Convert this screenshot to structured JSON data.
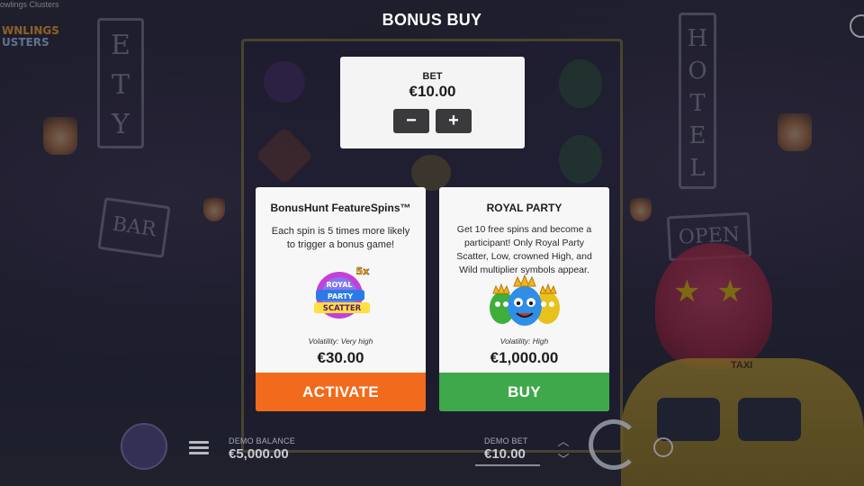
{
  "game": {
    "title": "owlings Clusters",
    "logo_line1": "WNLINGS",
    "logo_line2": "USTERS"
  },
  "scene_signs": {
    "ety": "E T Y",
    "hotel": "H O T E L",
    "bar": "BAR",
    "open": "OPEN",
    "taxi": "TAXI"
  },
  "popup": {
    "title": "BONUS BUY",
    "bet": {
      "label": "BET",
      "value": "€10.00",
      "minus": "−",
      "plus": "+"
    },
    "cards": [
      {
        "title": "BonusHunt FeatureSpins™",
        "description": "Each spin is 5 times more likely to trigger a bonus game!",
        "image_text": [
          "5x",
          "ROYAL",
          "PARTY",
          "SCATTER"
        ],
        "volatility": "Volatility: Very high",
        "price": "€30.00",
        "button": "ACTIVATE",
        "button_color": "#f26a1b"
      },
      {
        "title": "ROYAL PARTY",
        "description": "Get 10 free spins and become a participant! Only Royal Party Scatter, Low, crowned High, and Wild multiplier symbols appear.",
        "volatility": "Volatility: High",
        "price": "€1,000.00",
        "button": "BUY",
        "button_color": "#3fa84a"
      }
    ]
  },
  "footer": {
    "balance_label": "DEMO BALANCE",
    "balance_value": "€5,000.00",
    "bet_label": "DEMO BET",
    "bet_value": "€10.00"
  },
  "icons": {
    "menu": "menu-icon",
    "spin": "spin-icon",
    "autoplay": "autoplay-icon",
    "bet_up": "chevron-up-icon",
    "bet_down": "chevron-down-icon",
    "bet_minus": "minus-icon",
    "bet_plus": "plus-icon"
  }
}
